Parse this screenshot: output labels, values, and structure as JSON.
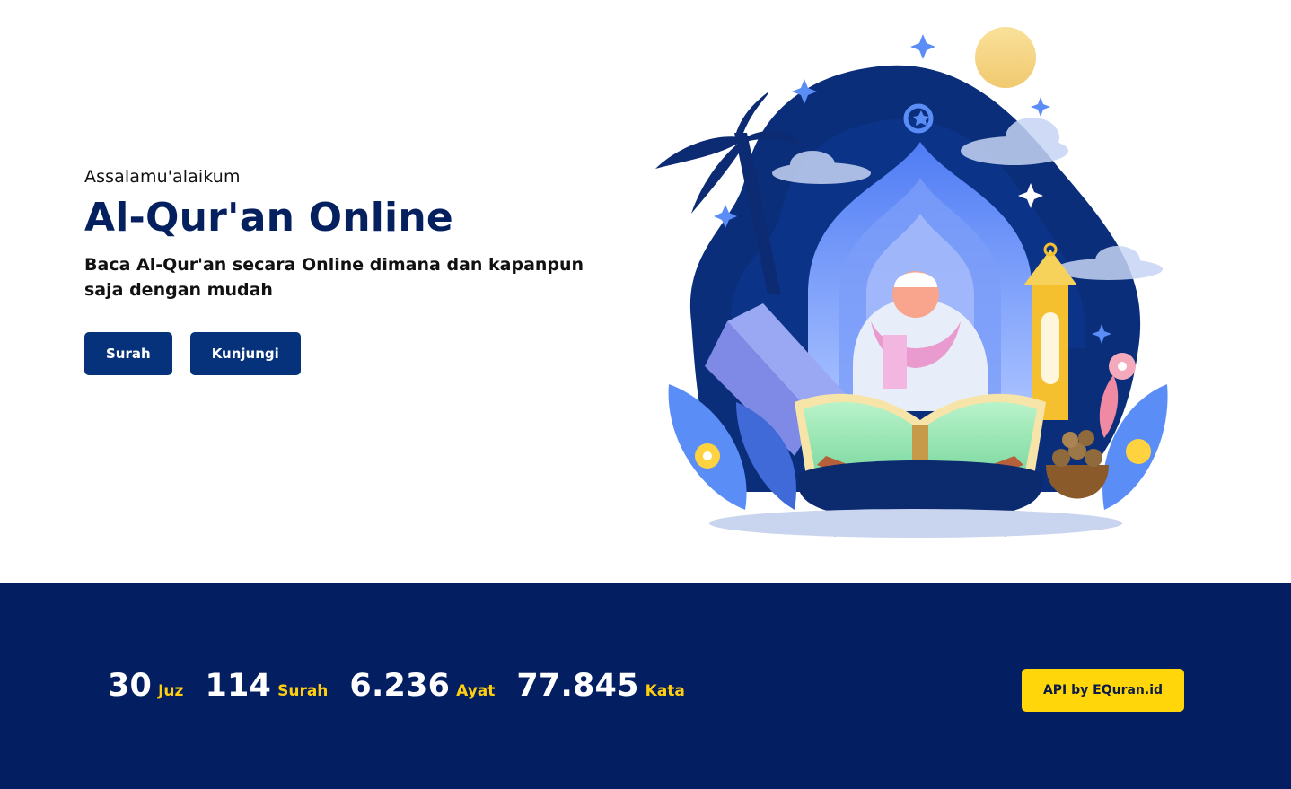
{
  "hero": {
    "greeting": "Assalamu'alaikum",
    "title": "Al-Qur'an Online",
    "subtitle": "Baca Al-Qur'an secara Online dimana dan kapanpun saja dengan mudah",
    "buttons": {
      "surah_label": "Surah",
      "kunjungi_label": "Kunjungi"
    },
    "illustration": "quran-reading-illustration"
  },
  "stats": {
    "items": [
      {
        "value": "30",
        "unit": "Juz"
      },
      {
        "value": "114",
        "unit": "Surah"
      },
      {
        "value": "6.236",
        "unit": "Ayat"
      },
      {
        "value": "77.845",
        "unit": "Kata"
      }
    ],
    "api_label": "API by EQuran.id"
  },
  "colors": {
    "primary": "#05327a",
    "title": "#05205e",
    "band": "#031e61",
    "accent": "#ffd60a",
    "unit": "#ffcf0f"
  }
}
